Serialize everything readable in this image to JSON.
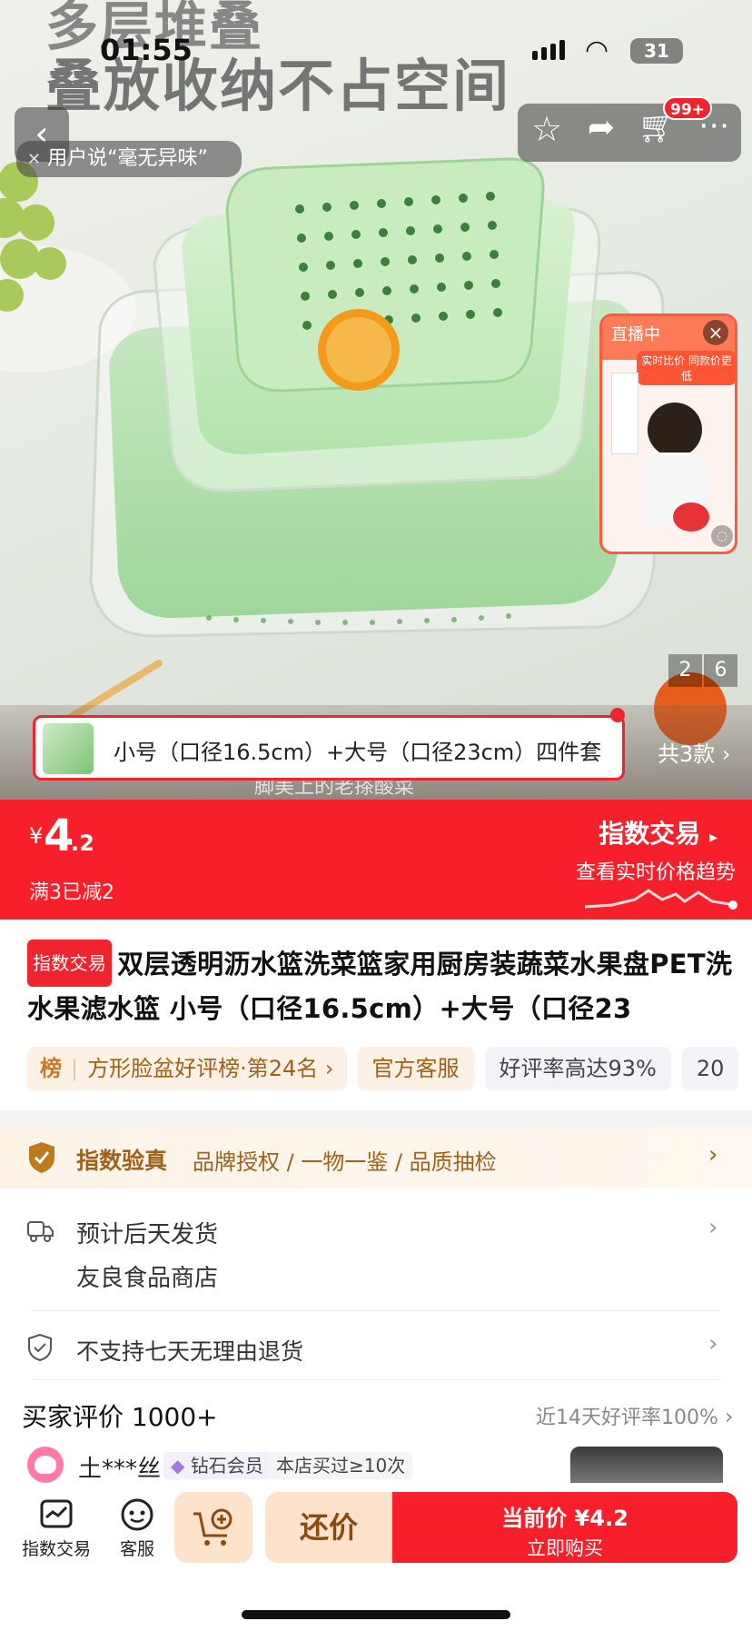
{
  "status_bar": {
    "time": "01:55",
    "battery": "31"
  },
  "hero": {
    "heading_line1": "多层堆叠",
    "heading_line2": "叠放收纳不占空间",
    "review_bubble": "用户说“毫无异味”",
    "cart_badge": "99+",
    "live": {
      "label": "直播中",
      "banner": "实时比价 同款价更低"
    },
    "page_current": "2",
    "page_total": "6",
    "caption": "脚美上的老搽酸菜"
  },
  "variant": {
    "text": "小号（口径16.5cm）+大号（口径23cm）四件套",
    "count": "共3款"
  },
  "price": {
    "currency": "¥",
    "integer": "4",
    "decimal": ".2",
    "promo": "满3已减2",
    "exchange_title": "指数交易",
    "exchange_sub": "查看实时价格趋势"
  },
  "product": {
    "badge": "指数交易",
    "title": "双层透明沥水篮洗菜篮家用厨房装蔬菜水果盘PET洗水果滤水篮 小号（口径16.5cm）+大号（口径23",
    "tags": [
      {
        "icon": "榜",
        "text": "方形脸盆好评榜·第24名 ›"
      },
      {
        "text": "官方客服"
      },
      {
        "text": "好评率高达93%"
      },
      {
        "text": "20"
      }
    ]
  },
  "verify": {
    "title": "指数验真",
    "items": "品牌授权 / 一物一鉴 / 品质抽检"
  },
  "shipping": {
    "line1": "预计后天发货",
    "line2": "友良食品商店"
  },
  "returns": {
    "text": "不支持七天无理由退货"
  },
  "reviews": {
    "title": "买家评价 1000+",
    "rate": "近14天好评率100%",
    "reviewer": "土***丝",
    "member": "钻石会员",
    "purchase": "本店买过≥10次"
  },
  "bottom": {
    "exchange": "指数交易",
    "service": "客服",
    "bargain": "还价",
    "buy_price": "当前价 ¥4.2",
    "buy_label": "立即购买"
  },
  "colors": {
    "accent_red": "#f7202a",
    "orange_tag": "#fdeede",
    "gold": "#b06a12"
  }
}
